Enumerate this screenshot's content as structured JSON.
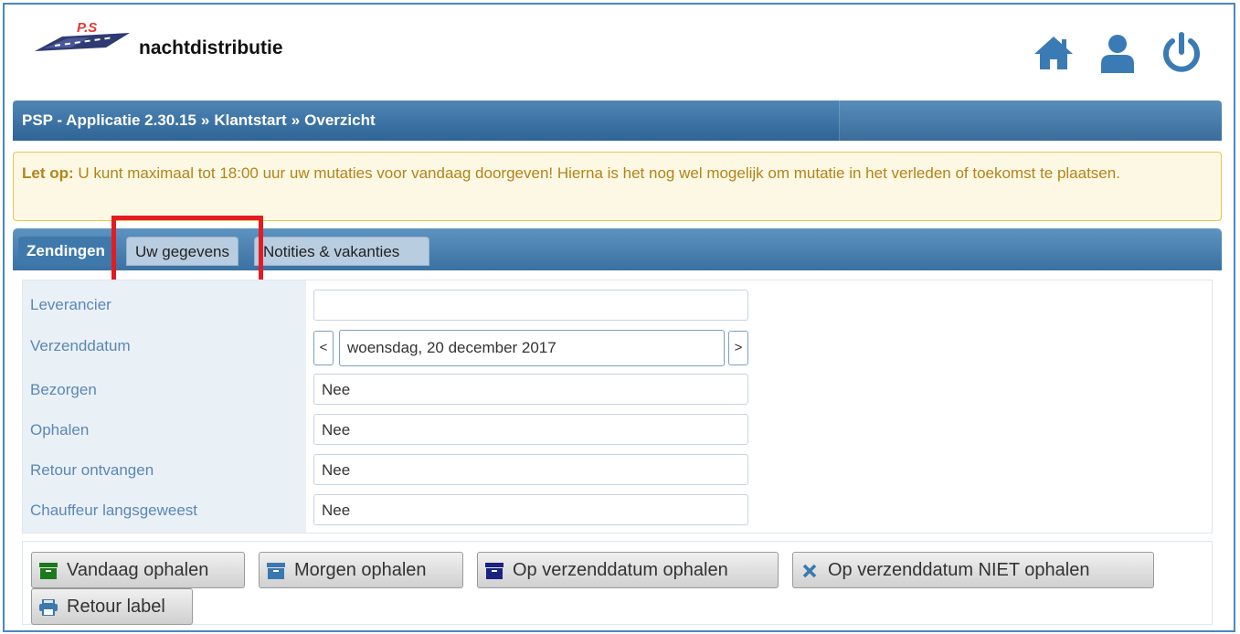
{
  "header": {
    "logo_text": "nachtdistributie",
    "logo_badge": "P.S",
    "icons": [
      "home-icon",
      "user-icon",
      "power-icon"
    ]
  },
  "breadcrumb": {
    "items": [
      "PSP - Applicatie 2.30.15",
      "Klantstart",
      "Overzicht"
    ],
    "separator": "»"
  },
  "warning": {
    "prefix": "Let op:",
    "message": " U kunt maximaal tot 18:00 uur uw mutaties voor vandaag doorgeven! Hierna is het nog wel mogelijk om mutatie in het verleden of toekomst te plaatsen."
  },
  "tabs": [
    {
      "label": "Zendingen"
    },
    {
      "label": "Uw gegevens"
    },
    {
      "label": "Notities & vakanties"
    }
  ],
  "form": {
    "leverancier": {
      "label": "Leverancier",
      "value": ""
    },
    "verzenddatum": {
      "label": "Verzenddatum",
      "value": "woensdag, 20 december 2017",
      "prev": "<",
      "next": ">"
    },
    "bezorgen": {
      "label": "Bezorgen",
      "value": "Nee"
    },
    "ophalen": {
      "label": "Ophalen",
      "value": "Nee"
    },
    "retour": {
      "label": "Retour ontvangen",
      "value": "Nee"
    },
    "chauffeur": {
      "label": "Chauffeur langsgeweest",
      "value": "Nee"
    }
  },
  "actions": {
    "vandaag": {
      "label": "Vandaag ophalen",
      "icon": "archive-icon",
      "color": "#1c7a1c"
    },
    "morgen": {
      "label": "Morgen ophalen",
      "icon": "archive-icon",
      "color": "#3a78b0"
    },
    "op_verzenddatum": {
      "label": "Op verzenddatum ophalen",
      "icon": "archive-icon",
      "color": "#1a237e"
    },
    "niet": {
      "label": "Op verzenddatum NIET ophalen",
      "icon": "close-icon",
      "color": "#3a78b0"
    },
    "retour_label": {
      "label": "Retour label",
      "icon": "print-icon",
      "color": "#3a78b0"
    }
  },
  "colors": {
    "accent": "#2f6495",
    "warning_text": "#b1841c",
    "highlight": "#e31b23"
  }
}
